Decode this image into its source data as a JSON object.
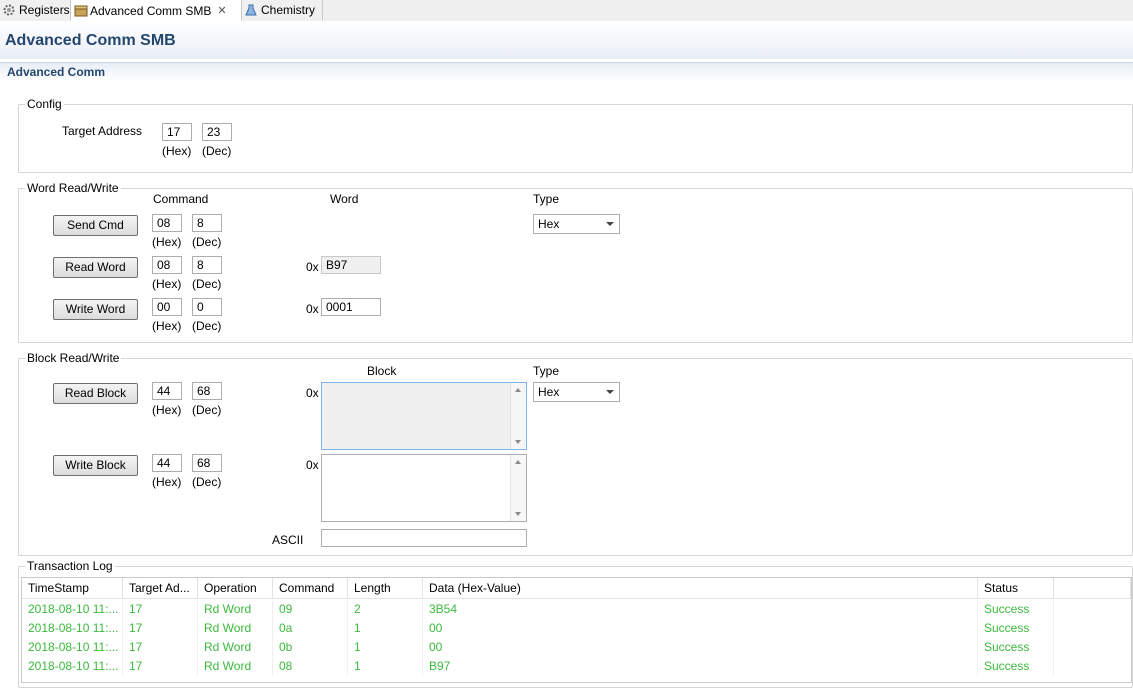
{
  "tabs": [
    {
      "label": "Registers",
      "icon": "gear-icon"
    },
    {
      "label": "Advanced Comm SMB",
      "icon": "package-icon",
      "active": true
    },
    {
      "label": "Chemistry",
      "icon": "flask-icon"
    }
  ],
  "header": {
    "title": "Advanced Comm SMB",
    "section": "Advanced Comm"
  },
  "config": {
    "group_label": "Config",
    "target_address_label": "Target Address",
    "hex_value": "17",
    "dec_value": "23",
    "hex_unit": "(Hex)",
    "dec_unit": "(Dec)"
  },
  "word_rw": {
    "group_label": "Word Read/Write",
    "command_header": "Command",
    "word_header": "Word",
    "type_header": "Type",
    "type_value": "Hex",
    "prefix": "0x",
    "hex_unit": "(Hex)",
    "dec_unit": "(Dec)",
    "rows": [
      {
        "button": "Send Cmd",
        "hex": "08",
        "dec": "8",
        "word": null
      },
      {
        "button": "Read Word",
        "hex": "08",
        "dec": "8",
        "word": "B97"
      },
      {
        "button": "Write Word",
        "hex": "00",
        "dec": "0",
        "word": "0001"
      }
    ]
  },
  "block_rw": {
    "group_label": "Block Read/Write",
    "block_header": "Block",
    "type_header": "Type",
    "type_value": "Hex",
    "prefix": "0x",
    "ascii_label": "ASCII",
    "ascii_value": "",
    "hex_unit": "(Hex)",
    "dec_unit": "(Dec)",
    "rows": [
      {
        "button": "Read Block",
        "hex": "44",
        "dec": "68",
        "block": ""
      },
      {
        "button": "Write Block",
        "hex": "44",
        "dec": "68",
        "block": ""
      }
    ]
  },
  "log": {
    "group_label": "Transaction Log",
    "columns": [
      "TimeStamp",
      "Target Ad...",
      "Operation",
      "Command",
      "Length",
      "Data (Hex-Value)",
      "Status"
    ],
    "rows": [
      [
        "2018-08-10 11:...",
        "17",
        "Rd Word",
        "09",
        "2",
        "3B54",
        "Success"
      ],
      [
        "2018-08-10 11:...",
        "17",
        "Rd Word",
        "0a",
        "1",
        "00",
        "Success"
      ],
      [
        "2018-08-10 11:...",
        "17",
        "Rd Word",
        "0b",
        "1",
        "00",
        "Success"
      ],
      [
        "2018-08-10 11:...",
        "17",
        "Rd Word",
        "08",
        "1",
        "B97",
        "Success"
      ]
    ],
    "row_color": "#3cb93c"
  },
  "colors": {
    "title": "#24466f",
    "success": "#3cb93c"
  }
}
